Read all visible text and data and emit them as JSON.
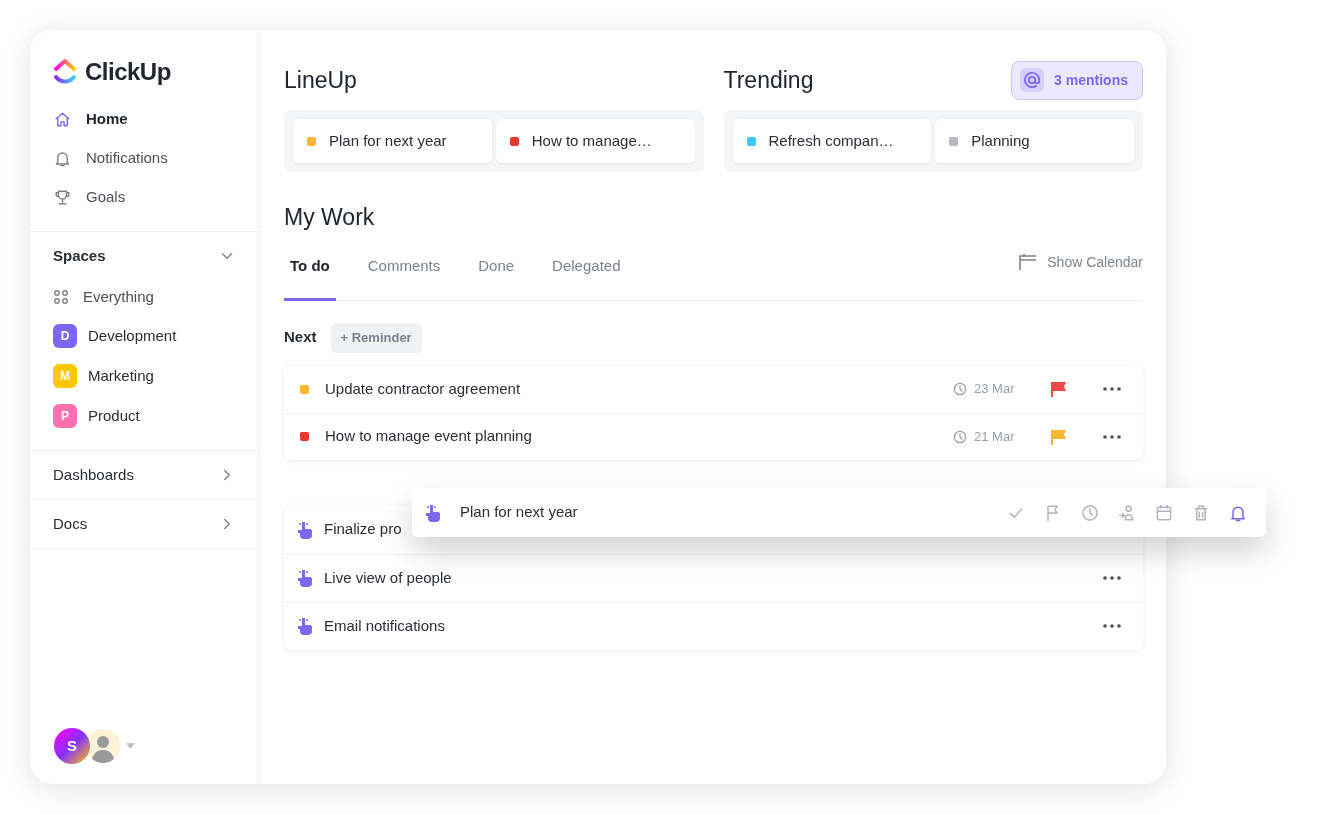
{
  "brand": {
    "name": "ClickUp"
  },
  "nav": [
    {
      "label": "Home",
      "selected": true
    },
    {
      "label": "Notifications",
      "selected": false
    },
    {
      "label": "Goals",
      "selected": false
    }
  ],
  "spaces": {
    "title": "Spaces",
    "expanded": true,
    "items": [
      {
        "kind": "all",
        "label": "Everything"
      },
      {
        "kind": "space",
        "initial": "D",
        "label": "Development",
        "color": "#7b68ee"
      },
      {
        "kind": "space",
        "initial": "M",
        "label": "Marketing",
        "color": "#ffc800"
      },
      {
        "kind": "space",
        "initial": "P",
        "label": "Product",
        "color": "#fd71af"
      }
    ]
  },
  "sections": [
    {
      "label": "Dashboards"
    },
    {
      "label": "Docs"
    }
  ],
  "user": {
    "initial": "S"
  },
  "lineup": {
    "title": "LineUp",
    "items": [
      {
        "label": "Plan for next year",
        "color": "#fbb635"
      },
      {
        "label": "How to manage…",
        "color": "#e53a2b"
      }
    ]
  },
  "trending": {
    "title": "Trending",
    "items": [
      {
        "label": "Refresh compan…",
        "color": "#3fc7f5"
      },
      {
        "label": "Planning",
        "color": "#b9b9c6"
      }
    ]
  },
  "mentions": "3 mentions",
  "my_work": {
    "title": "My Work",
    "tabs": [
      {
        "label": "To do",
        "selected": true
      },
      {
        "label": "Comments",
        "selected": false
      },
      {
        "label": "Done",
        "selected": false
      },
      {
        "label": "Delegated",
        "selected": false
      }
    ],
    "show_calendar": "Show Calendar",
    "next_label": "Next",
    "reminder_button": "+ Reminder",
    "tasks": [
      {
        "title": "Update contractor agreement",
        "color": "#fbb635",
        "date": "23 Mar",
        "flag": {
          "color": "#f0474b"
        }
      },
      {
        "title": "How to manage event planning",
        "color": "#e53a2b",
        "date": "21 Mar",
        "flag": {
          "color": "#fbb635"
        }
      }
    ],
    "reminders": [
      {
        "title": "Finalize pro"
      },
      {
        "title": "Live view of people"
      },
      {
        "title": "Email notifications"
      }
    ]
  },
  "dragged": {
    "title": "Plan for next year",
    "actions": [
      {
        "kind": "check",
        "selected": false
      },
      {
        "kind": "flag",
        "selected": false
      },
      {
        "kind": "clock",
        "selected": false
      },
      {
        "kind": "assign",
        "selected": false
      },
      {
        "kind": "calendar",
        "selected": false
      },
      {
        "kind": "trash",
        "selected": false
      },
      {
        "kind": "bell",
        "selected": true
      }
    ]
  }
}
